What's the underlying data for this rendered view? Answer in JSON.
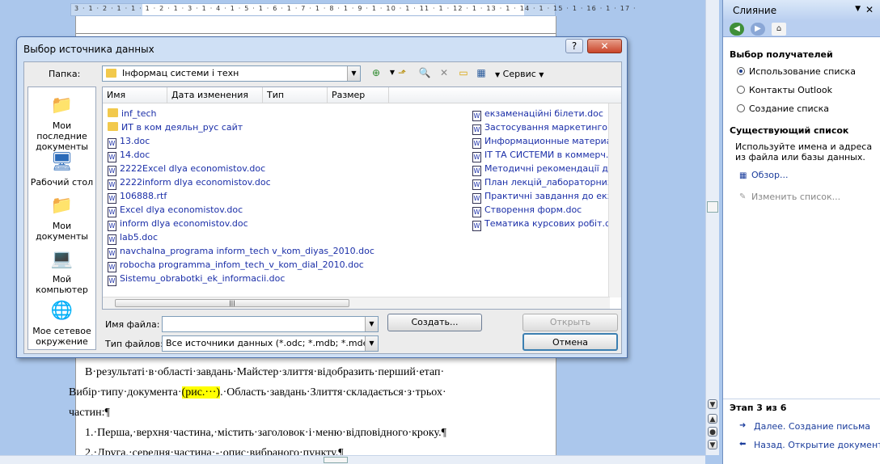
{
  "ruler": {
    "numbers": "3 · 1 · 2 · 1 · 1 · 1 · 2 · 1 · 3 · 1 · 4 · 1 · 5 · 1 · 6 · 1 · 7 · 1 · 8 · 1 · 9 · 1 · 10 · 1 · 11 · 1 · 12 · 1 · 13 · 1 · 14 · 1 · 15 · 1 · 16 · 1 · 17 ·"
  },
  "document": {
    "lines": [
      {
        "pre": "В·результаті·в·області·завдань·Майстер·злиття·відобразить·перший·етап·",
        "hl": "",
        "post": ""
      },
      {
        "pre": "Вибір·типу·документа·",
        "hl": "(рис.···)",
        "post": ".·Область·завдань·Злиття·складається·з·трьох·"
      },
      {
        "pre": "частин:¶",
        "hl": "",
        "post": ""
      },
      {
        "pre": "1.·Перша,·верхня·частина,·містить·заголовок·і·меню·відповідного·кроку.¶",
        "hl": "",
        "post": ""
      },
      {
        "pre": "2.·Друга,·середня·частина·-·опис·вибраного·пункту.¶",
        "hl": "",
        "post": ""
      }
    ]
  },
  "task_pane": {
    "title": "Слияние",
    "section_recipients": "Выбор получателей",
    "options": [
      "Использование списка",
      "Контакты Outlook",
      "Создание списка"
    ],
    "selected_option": 0,
    "section_existing": "Существующий список",
    "existing_desc": "Используйте имена и адреса из файла или базы данных.",
    "browse_link": "Обзор...",
    "edit_link": "Изменить список...",
    "step": "Этап 3 из 6",
    "next_link": "Далее. Создание письма",
    "back_link": "Назад. Открытие документа"
  },
  "dialog": {
    "title": "Выбор источника данных",
    "folder_label": "Папка:",
    "folder_value": "Інформац системи і техн",
    "service_label": "Сервис",
    "places": [
      "Мои последние документы",
      "Рабочий стол",
      "Мои документы",
      "Мой компьютер",
      "Мое сетевое окружение"
    ],
    "columns": [
      "Имя",
      "Дата изменения",
      "Тип",
      "Размер"
    ],
    "files_left": [
      {
        "name": "inf_tech",
        "kind": "folder"
      },
      {
        "name": "ИТ в ком деяльн_рус сайт",
        "kind": "folder"
      },
      {
        "name": "13.doc",
        "kind": "doc"
      },
      {
        "name": "14.doc",
        "kind": "doc"
      },
      {
        "name": "2222Excel dlya economistov.doc",
        "kind": "doc"
      },
      {
        "name": "2222inform dlya economistov.doc",
        "kind": "doc"
      },
      {
        "name": "106888.rtf",
        "kind": "rtf"
      },
      {
        "name": "Excel dlya economistov.doc",
        "kind": "doc"
      },
      {
        "name": "inform dlya economistov.doc",
        "kind": "doc"
      },
      {
        "name": "lab5.doc",
        "kind": "doc"
      },
      {
        "name": "navchalna_programa inform_tech v_kom_diyas_2010.doc",
        "kind": "doc"
      },
      {
        "name": "robocha programma_infom_tech_v_kom_dial_2010.doc",
        "kind": "doc"
      },
      {
        "name": "Sistemu_obrabotki_ek_informacii.doc",
        "kind": "doc"
      }
    ],
    "files_right": [
      {
        "name": "екзаменаційні білети.doc",
        "kind": "doc"
      },
      {
        "name": "Застосування маркетингових і",
        "kind": "doc"
      },
      {
        "name": "Информационные материалы",
        "kind": "doc"
      },
      {
        "name": "ІТ ТА СИСТЕМИ в коммерч.де",
        "kind": "doc"
      },
      {
        "name": "Методичні рекомендації до кур",
        "kind": "doc"
      },
      {
        "name": "План лекцій_лабораторних ро",
        "kind": "doc"
      },
      {
        "name": "Практичні завдання до екзаме",
        "kind": "doc"
      },
      {
        "name": "Створення форм.doc",
        "kind": "doc"
      },
      {
        "name": "Тематика курсових робіт.doc",
        "kind": "doc"
      }
    ],
    "filename_label": "Имя файла:",
    "filename_value": "",
    "filetype_label": "Тип файлов:",
    "filetype_value": "Все источники данных (*.odc; *.mdb; *.mde; *.a",
    "create_button": "Создать...",
    "open_button": "Открыть",
    "cancel_button": "Отмена"
  }
}
